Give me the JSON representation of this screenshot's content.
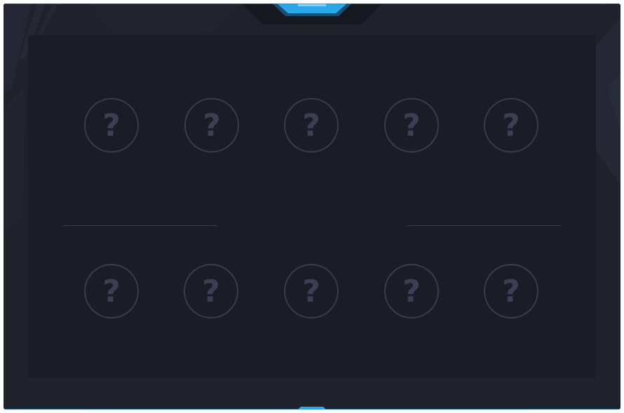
{
  "theme": {
    "accent": "#2aa8e8",
    "frame_bg": "#1f212b",
    "panel_bg": "#1b1d26",
    "slot_border": "#393b4f",
    "slot_glyph": "#3c3e54"
  },
  "top_team": {
    "slots": [
      {
        "state": "unknown",
        "glyph": "?"
      },
      {
        "state": "unknown",
        "glyph": "?"
      },
      {
        "state": "unknown",
        "glyph": "?"
      },
      {
        "state": "unknown",
        "glyph": "?"
      },
      {
        "state": "unknown",
        "glyph": "?"
      }
    ]
  },
  "bottom_team": {
    "slots": [
      {
        "state": "unknown",
        "glyph": "?"
      },
      {
        "state": "unknown",
        "glyph": "?"
      },
      {
        "state": "unknown",
        "glyph": "?"
      },
      {
        "state": "unknown",
        "glyph": "?"
      },
      {
        "state": "unknown",
        "glyph": "?"
      }
    ]
  }
}
